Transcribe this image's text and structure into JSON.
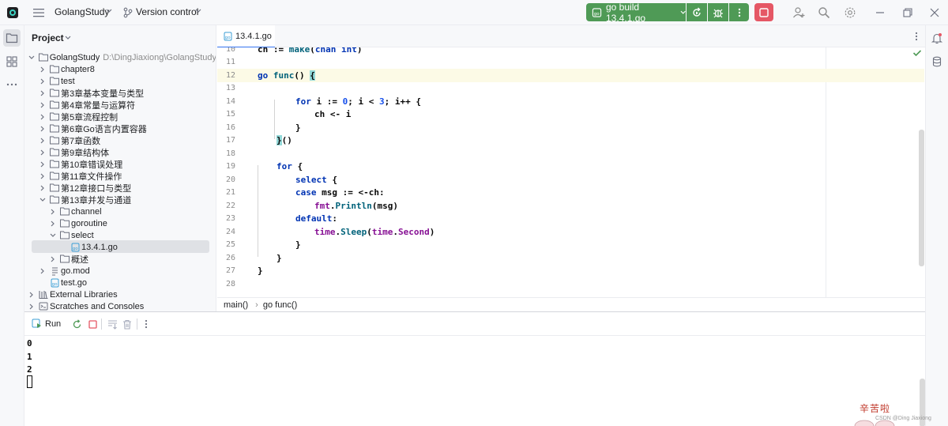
{
  "titlebar": {
    "project_name": "GolangStudy",
    "vcs_label": "Version control",
    "run_config_label": "go build 13.4.1.go"
  },
  "project_panel": {
    "header": "Project",
    "root_name": "GolangStudy",
    "root_path": "D:\\DingJiaxiong\\GolangStudy",
    "items": [
      {
        "label": "chapter8"
      },
      {
        "label": "test"
      },
      {
        "label": "第3章基本变量与类型"
      },
      {
        "label": "第4章常量与运算符"
      },
      {
        "label": "第5章流程控制"
      },
      {
        "label": "第6章Go语言内置容器"
      },
      {
        "label": "第7章函数"
      },
      {
        "label": "第9章结构体"
      },
      {
        "label": "第10章错误处理"
      },
      {
        "label": "第11章文件操作"
      },
      {
        "label": "第12章接口与类型"
      },
      {
        "label": "第13章并发与通道"
      },
      {
        "label": "channel"
      },
      {
        "label": "goroutine"
      },
      {
        "label": "select"
      },
      {
        "label": "13.4.1.go"
      },
      {
        "label": "概述"
      },
      {
        "label": "go.mod"
      },
      {
        "label": "test.go"
      },
      {
        "label": "External Libraries"
      },
      {
        "label": "Scratches and Consoles"
      }
    ]
  },
  "editor": {
    "tab_label": "13.4.1.go",
    "line_numbers": [
      "10",
      "11",
      "12",
      "13",
      "14",
      "15",
      "16",
      "17",
      "18",
      "19",
      "20",
      "21",
      "22",
      "23",
      "24",
      "25",
      "26",
      "27",
      "28"
    ],
    "tokens": {
      "l10": "ch := make(chan int)",
      "ch": "ch",
      "assign": " := ",
      "make": "make",
      "lparen": "(",
      "chan": "chan",
      "int": "int",
      "rparen": ")",
      "go": "go",
      "func": "func",
      "func_paren": "() ",
      "open_brace": "{",
      "for": "for",
      "i": " i ",
      "decl": ":= ",
      "zero": "0",
      "cond_a": "; i < ",
      "three": "3",
      "cond_b": "; i++ {",
      "send": "ch <- i",
      "close_brace": "}",
      "close_call": "}",
      "call_paren": "()",
      "for_open": " {",
      "select": "select",
      "case": "case",
      "case_rest": " msg := <-ch:",
      "fmt": "fmt",
      "dot": ".",
      "println": "Println",
      "println_args": "(msg)",
      "default": "default",
      "colon": ":",
      "time": "time",
      "sleep": "Sleep",
      "second": "Second"
    }
  },
  "breadcrumb": {
    "first": "main()",
    "separator": "›",
    "second": "go func()"
  },
  "run_panel": {
    "tab_label": "Run",
    "output": [
      "0",
      "1",
      "2"
    ]
  },
  "sticker": {
    "text": "辛苦啦",
    "watermark": "CSDN @Ding Jiaxiong"
  },
  "colors": {
    "run_green": "#4f9a56",
    "stop_red": "#e55765",
    "keyword": "#0033b3",
    "function": "#00627a",
    "package": "#871094",
    "number": "#1750eb",
    "current_line": "#fcfae6",
    "selection": "#dfe1e5",
    "accent": "#3574f0"
  }
}
